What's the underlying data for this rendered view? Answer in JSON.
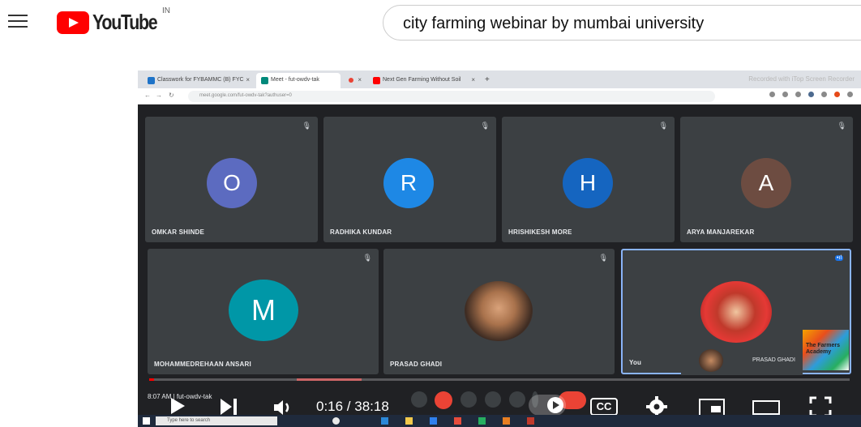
{
  "youtube": {
    "logo_text": "YouTube",
    "country_code": "IN",
    "search_query": "city farming webinar by mumbai university"
  },
  "browser": {
    "tabs": [
      {
        "label": "Classwork for FYBAMMC (B) FYC",
        "icon_color": "#1e73c8"
      },
      {
        "label": "Meet - fut-owdv-tak",
        "icon_color": "#00897b"
      },
      {
        "label": "",
        "icon_color": "#ea4335"
      },
      {
        "label": "Next Gen Farming Without Soil",
        "icon_color": "#ff0000"
      }
    ],
    "recorded_text": "Recorded with iTop Screen Recorder",
    "url": "meet.google.com/fut-owdv-tak?authuser=0"
  },
  "meet": {
    "participants": [
      {
        "name": "OMKAR SHINDE",
        "initial": "O",
        "color": "#5c6bc0"
      },
      {
        "name": "RADHIKA KUNDAR",
        "initial": "R",
        "color": "#1e88e5"
      },
      {
        "name": "HRISHIKESH MORE",
        "initial": "H",
        "color": "#1565c0"
      },
      {
        "name": "ARYA MANJAREKAR",
        "initial": "A",
        "color": "#6d4c41"
      },
      {
        "name": "MOHAMMEDREHAAN ANSARI",
        "initial": "M",
        "color": "#0097a7"
      },
      {
        "name": "PRASAD GHADI",
        "initial": "",
        "color": "#8d6e63"
      },
      {
        "name": "You",
        "initial": "",
        "color": "#d32f2f"
      }
    ],
    "self_preview_name": "PRASAD GHADI",
    "logo_card_text": "The Farmers Academy",
    "meeting_meta": "8:07 AM  |  fut-owdv-tak"
  },
  "player": {
    "current_time": "0:16 / 38:18",
    "progress": 0.007,
    "buffered": 0.04
  },
  "taskbar": {
    "search_placeholder": "Type here to search"
  }
}
